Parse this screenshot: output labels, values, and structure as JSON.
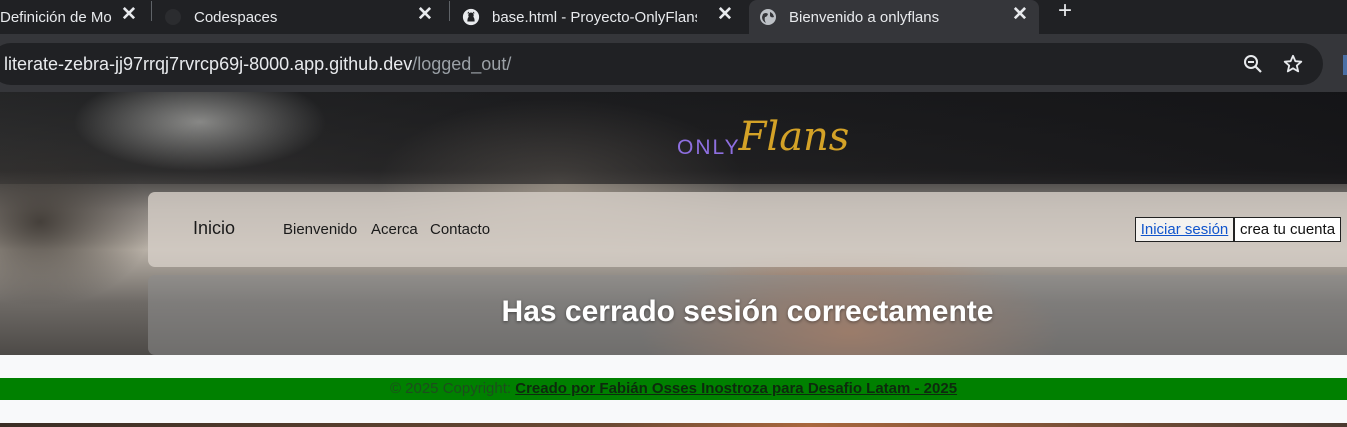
{
  "browser": {
    "tabs": [
      {
        "title": "Definición de Mo",
        "active": false
      },
      {
        "title": "Codespaces",
        "active": false
      },
      {
        "title": "base.html - Proyecto-OnlyFlans",
        "active": false
      },
      {
        "title": "Bienvenido a onlyflans",
        "active": true
      }
    ],
    "new_tab_label": "+",
    "close_glyph": "✕",
    "url": {
      "host": "literate-zebra-jj97rrqj7rvrcp69j-8000.app.github.dev",
      "path": "/logged_out/"
    },
    "icons": [
      "zoom-out-icon",
      "bookmark-star-icon",
      "globe-icon",
      "github-icon"
    ],
    "colors": {
      "tab_strip": "#202124",
      "toolbar": "#35363a"
    }
  },
  "site": {
    "logo": {
      "only": "ONLY",
      "flans": "Flans"
    },
    "nav": {
      "brand": "Inicio",
      "links": [
        "Bienvenido",
        "Acerca",
        "Contacto"
      ],
      "login_label": "Iniciar sesión",
      "signup_label": "crea tu cuenta"
    },
    "message": "Has cerrado sesión correctamente",
    "footer": {
      "copyright": "© 2025 Copyright: ",
      "credit": "Creado por Fabián Osses Inostroza para Desafio Latam - 2025"
    },
    "colors": {
      "logo_only": "#8e6fe0",
      "logo_flans": "#d4a227",
      "footer_bg": "#008000",
      "link": "#1155cc"
    }
  }
}
